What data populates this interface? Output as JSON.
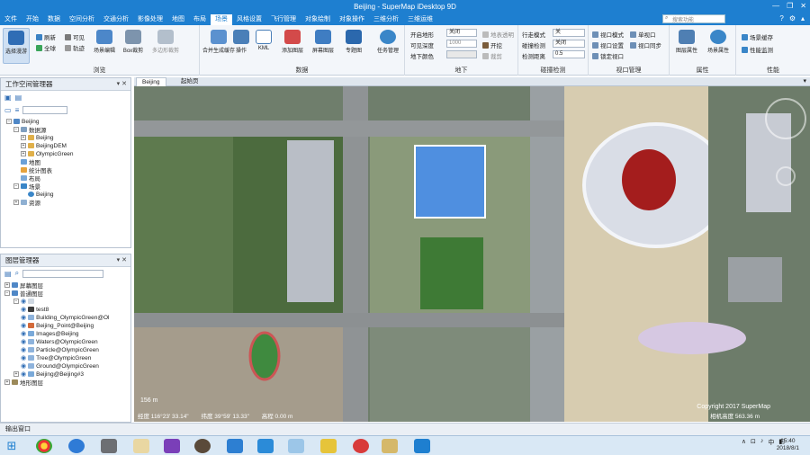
{
  "window": {
    "title": "Beijing - SuperMap iDesktop 9D",
    "search_placeholder": "搜索功能",
    "controls": [
      "—",
      "❐",
      "✕"
    ]
  },
  "menu": [
    {
      "label": "文件"
    },
    {
      "label": "开始"
    },
    {
      "label": "数据"
    },
    {
      "label": "空间分析"
    },
    {
      "label": "交通分析"
    },
    {
      "label": "影像处理"
    },
    {
      "label": "地图"
    },
    {
      "label": "布局"
    },
    {
      "label": "场景",
      "active": true
    },
    {
      "label": "风格设置"
    },
    {
      "label": "飞行管理"
    },
    {
      "label": "对象绘制"
    },
    {
      "label": "对象操作"
    },
    {
      "label": "三维分析"
    },
    {
      "label": "三维运维"
    }
  ],
  "ribbon": {
    "groups": [
      {
        "label": "浏览"
      },
      {
        "label": "数据"
      },
      {
        "label": "地下"
      },
      {
        "label": "碰撞检测"
      },
      {
        "label": "视口管理"
      },
      {
        "label": "属性"
      },
      {
        "label": "性能"
      }
    ],
    "browse": {
      "select_mode": "选择漫游",
      "refresh": "刷新",
      "full_extent": "全球",
      "visible": "可见",
      "trajectory": "轨迹",
      "scene_edit": "场景编辑",
      "box_clip": "Box裁剪",
      "multi_clip": "多边形裁剪"
    },
    "data": {
      "generate_cache": "合并生成缓存",
      "operate": "操作",
      "kml": "KML",
      "add_layer": "添加图层",
      "screen_layer": "屏幕图层",
      "thematic": "专题图",
      "terrain_process": "任务管理"
    },
    "underground": {
      "row1_label": "开启地形",
      "row1_value": "关闭",
      "row2_label": "可见深度",
      "row2_value": "1000",
      "row3_label": "地下颜色",
      "clip_opacity": "地表透明",
      "open": "开挖",
      "clip": "裁剪"
    },
    "collision": {
      "row1_label": "行走模式",
      "row1_value": "关",
      "row2_label": "碰撞检测",
      "row2_value": "关闭",
      "row3_label": "检测距离",
      "row3_value": "0.5"
    },
    "viewport": {
      "view_mode": "视口模式",
      "single": "单视口",
      "set": "视口设置",
      "lock_view": "视口同步",
      "lock_viewport": "锁定视口"
    },
    "props": {
      "layer_prop": "图层属性",
      "scene_prop": "场景属性"
    },
    "perf": {
      "scene_cache": "场景缓存",
      "perf_monitor": "性能监测"
    }
  },
  "workspace": {
    "title": "工作空间管理器",
    "tree": [
      {
        "label": "Beijing",
        "level": 0,
        "expanded": true
      },
      {
        "label": "数据源",
        "level": 1,
        "expanded": true
      },
      {
        "label": "Beijing",
        "level": 2
      },
      {
        "label": "BeijingDEM",
        "level": 2
      },
      {
        "label": "OlympicGreen",
        "level": 2
      },
      {
        "label": "地图",
        "level": 1
      },
      {
        "label": "统计图表",
        "level": 1
      },
      {
        "label": "布局",
        "level": 1
      },
      {
        "label": "场景",
        "level": 1,
        "expanded": true
      },
      {
        "label": "Beijing",
        "level": 2
      },
      {
        "label": "资源",
        "level": 1
      }
    ]
  },
  "layers": {
    "title": "图层管理器",
    "tree": [
      {
        "label": "屏幕图层",
        "level": 0
      },
      {
        "label": "普通图层",
        "level": 0
      },
      {
        "label": "",
        "level": 1
      },
      {
        "label": "test8",
        "level": 2
      },
      {
        "label": "Building_OlympicGreen@Ol",
        "level": 2
      },
      {
        "label": "Beijing_Point@Beijing",
        "level": 2
      },
      {
        "label": "Images@Beijing",
        "level": 2
      },
      {
        "label": "Waters@OlympicGreen",
        "level": 2
      },
      {
        "label": "Particle@OlympicGreen",
        "level": 2
      },
      {
        "label": "Tree@OlympicGreen",
        "level": 2
      },
      {
        "label": "Ground@OlympicGreen",
        "level": 2
      },
      {
        "label": "Beijing@Beijing#3",
        "level": 1
      },
      {
        "label": "地形图层",
        "level": 0
      }
    ]
  },
  "doc_tabs": [
    {
      "label": "Beijing",
      "active": true
    },
    {
      "label": "起始页",
      "active": false
    }
  ],
  "scene": {
    "scale": "156 m",
    "status_lon": "经度 116°23' 33.14\"",
    "status_lat": "纬度 39°59' 13.33\"",
    "status_alt": "高程 0.00 m",
    "camera_height": "相机高度 563.36 m",
    "copyright": "Copyright 2017 SuperMap"
  },
  "output": {
    "label": "输出窗口"
  },
  "taskbar": {
    "time": "15:40",
    "date": "2018/8/1",
    "tray": [
      "∧",
      "⊡",
      "♪",
      "中",
      "◧"
    ]
  },
  "colors": {
    "accent": "#1e7fd0",
    "ribbon_bg": "#f3f6fa",
    "taskbar": "#d9e8f5"
  }
}
